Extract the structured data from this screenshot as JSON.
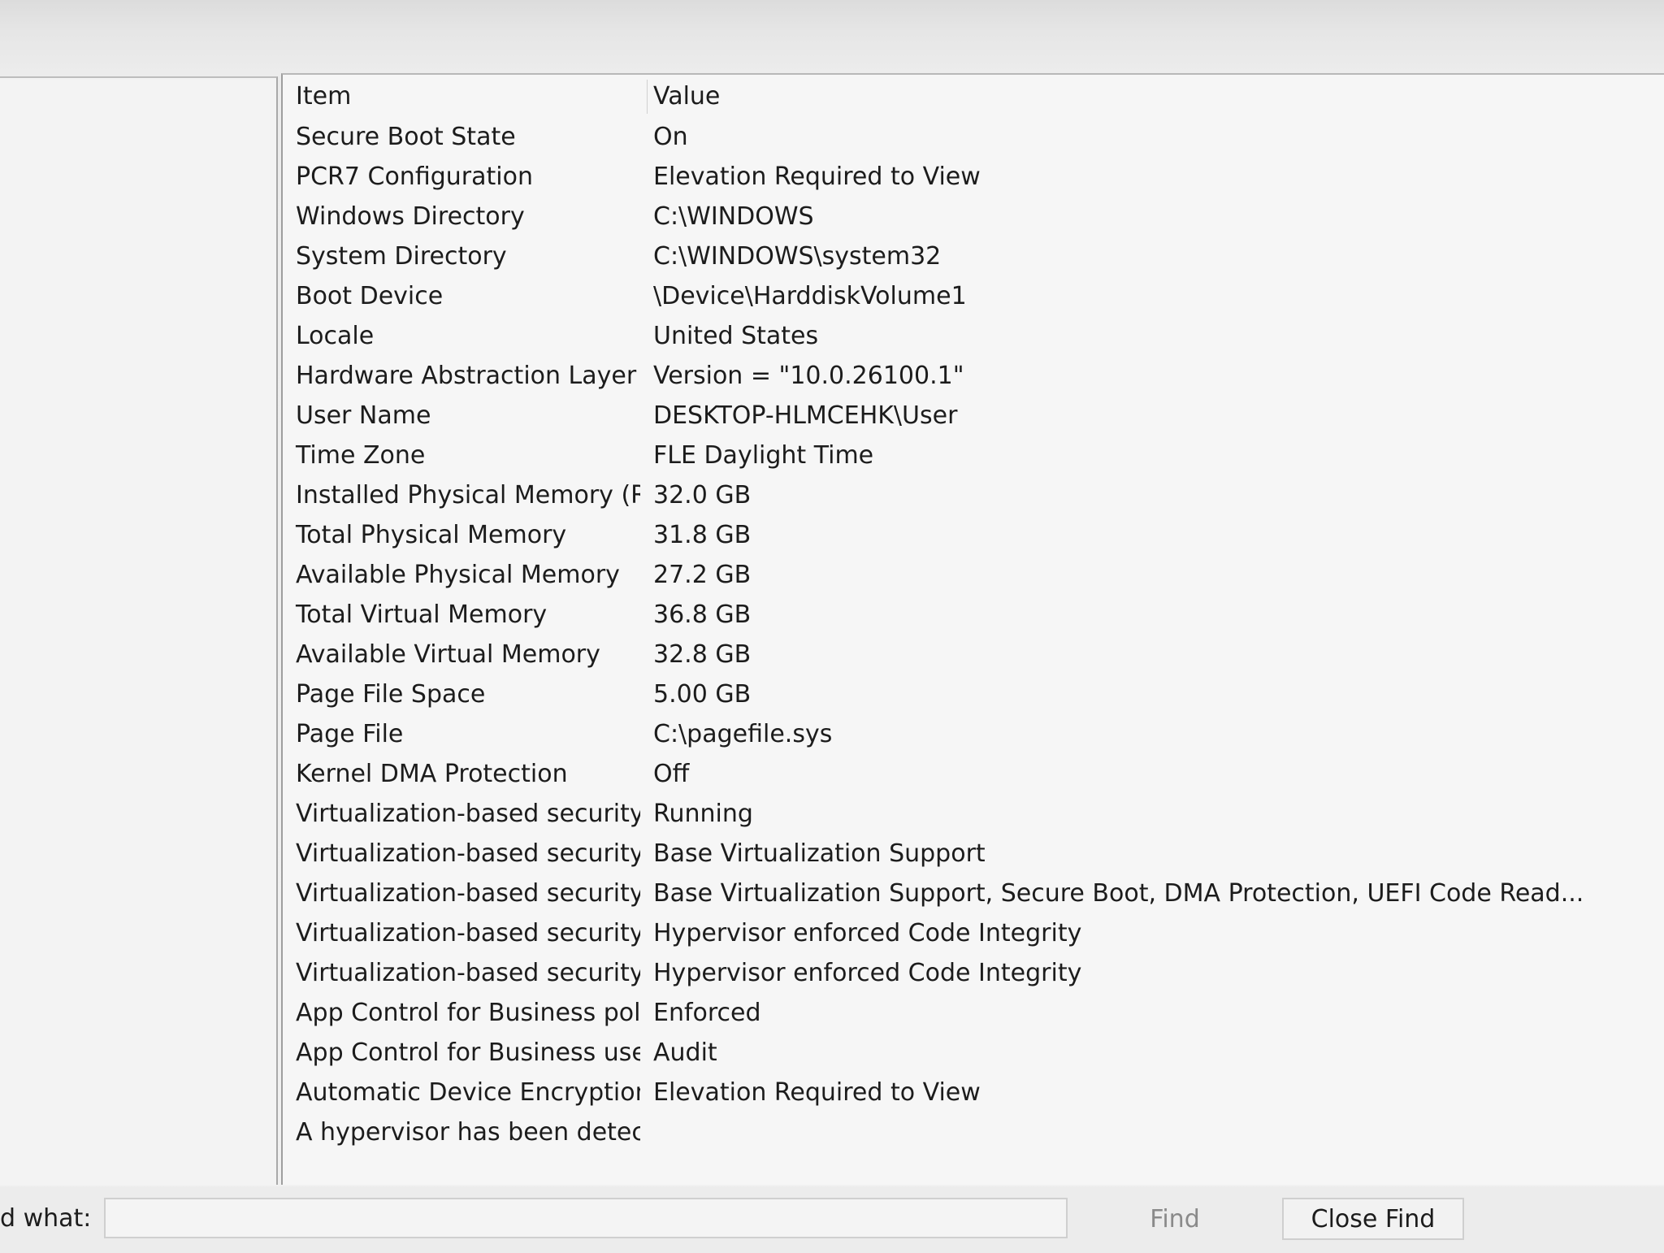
{
  "list": {
    "columns": {
      "item": "Item",
      "value": "Value"
    },
    "rows": [
      {
        "item": "Secure Boot State",
        "value": "On"
      },
      {
        "item": "PCR7 Configuration",
        "value": "Elevation Required to View"
      },
      {
        "item": "Windows Directory",
        "value": "C:\\WINDOWS"
      },
      {
        "item": "System Directory",
        "value": "C:\\WINDOWS\\system32"
      },
      {
        "item": "Boot Device",
        "value": "\\Device\\HarddiskVolume1"
      },
      {
        "item": "Locale",
        "value": "United States"
      },
      {
        "item": "Hardware Abstraction Layer",
        "value": "Version = \"10.0.26100.1\""
      },
      {
        "item": "User Name",
        "value": "DESKTOP-HLMCEHK\\User"
      },
      {
        "item": "Time Zone",
        "value": "FLE Daylight Time"
      },
      {
        "item": "Installed Physical Memory (RA...",
        "value": "32.0 GB"
      },
      {
        "item": "Total Physical Memory",
        "value": "31.8 GB"
      },
      {
        "item": "Available Physical Memory",
        "value": "27.2 GB"
      },
      {
        "item": "Total Virtual Memory",
        "value": "36.8 GB"
      },
      {
        "item": "Available Virtual Memory",
        "value": "32.8 GB"
      },
      {
        "item": "Page File Space",
        "value": "5.00 GB"
      },
      {
        "item": "Page File",
        "value": "C:\\pagefile.sys"
      },
      {
        "item": "Kernel DMA Protection",
        "value": "Off"
      },
      {
        "item": "Virtualization-based security",
        "value": "Running"
      },
      {
        "item": "Virtualization-based security ...",
        "value": "Base Virtualization Support"
      },
      {
        "item": "Virtualization-based security ...",
        "value": "Base Virtualization Support, Secure Boot, DMA Protection, UEFI Code Read..."
      },
      {
        "item": "Virtualization-based security S...",
        "value": "Hypervisor enforced Code Integrity"
      },
      {
        "item": "Virtualization-based security S...",
        "value": "Hypervisor enforced Code Integrity"
      },
      {
        "item": "App Control for Business policy",
        "value": "Enforced"
      },
      {
        "item": "App Control for Business user ...",
        "value": "Audit"
      },
      {
        "item": "Automatic Device Encryption ...",
        "value": "Elevation Required to View"
      },
      {
        "item": "A hypervisor has been detecte...",
        "value": ""
      }
    ]
  },
  "find_bar": {
    "label": "d what:",
    "input_value": "",
    "find_label": "Find",
    "close_label": "Close Find"
  }
}
